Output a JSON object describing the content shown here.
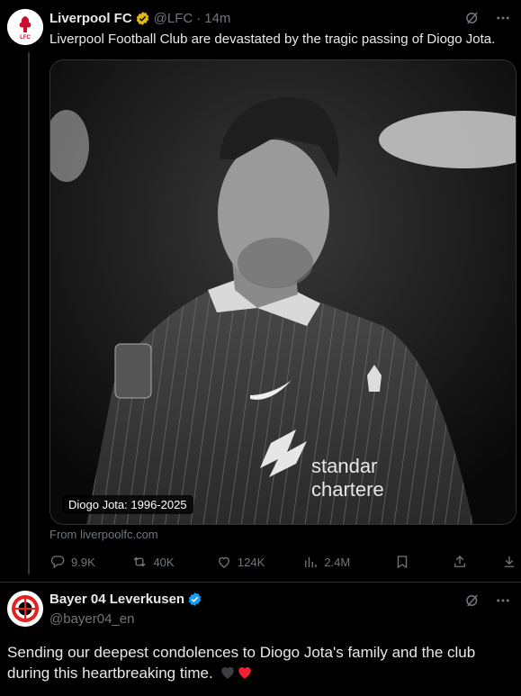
{
  "tweet1": {
    "name": "Liverpool FC",
    "handle": "@LFC",
    "separator": "·",
    "time": "14m",
    "text": "Liverpool Football Club are devastated by the tragic passing of Diogo Jota.",
    "media_caption": "Diogo Jota: 1996-2025",
    "source": "From liverpoolfc.com",
    "avatar_text": "LFC",
    "actions": {
      "replies": "9.9K",
      "reposts": "40K",
      "likes": "124K",
      "views": "2.4M"
    }
  },
  "tweet2": {
    "name": "Bayer 04 Leverkusen",
    "handle": "@bayer04_en",
    "text": "Sending our deepest condolences to Diogo Jota's family and the club during this heartbreaking time."
  },
  "colors": {
    "background": "#000000",
    "text": "#e7e9ea",
    "muted": "#71767b",
    "gold_badge": "#e2b719",
    "blue_badge": "#1d9bf0",
    "lfc_red": "#c8102e",
    "heart_red": "#f4212e",
    "heart_black": "#3b3f44"
  }
}
